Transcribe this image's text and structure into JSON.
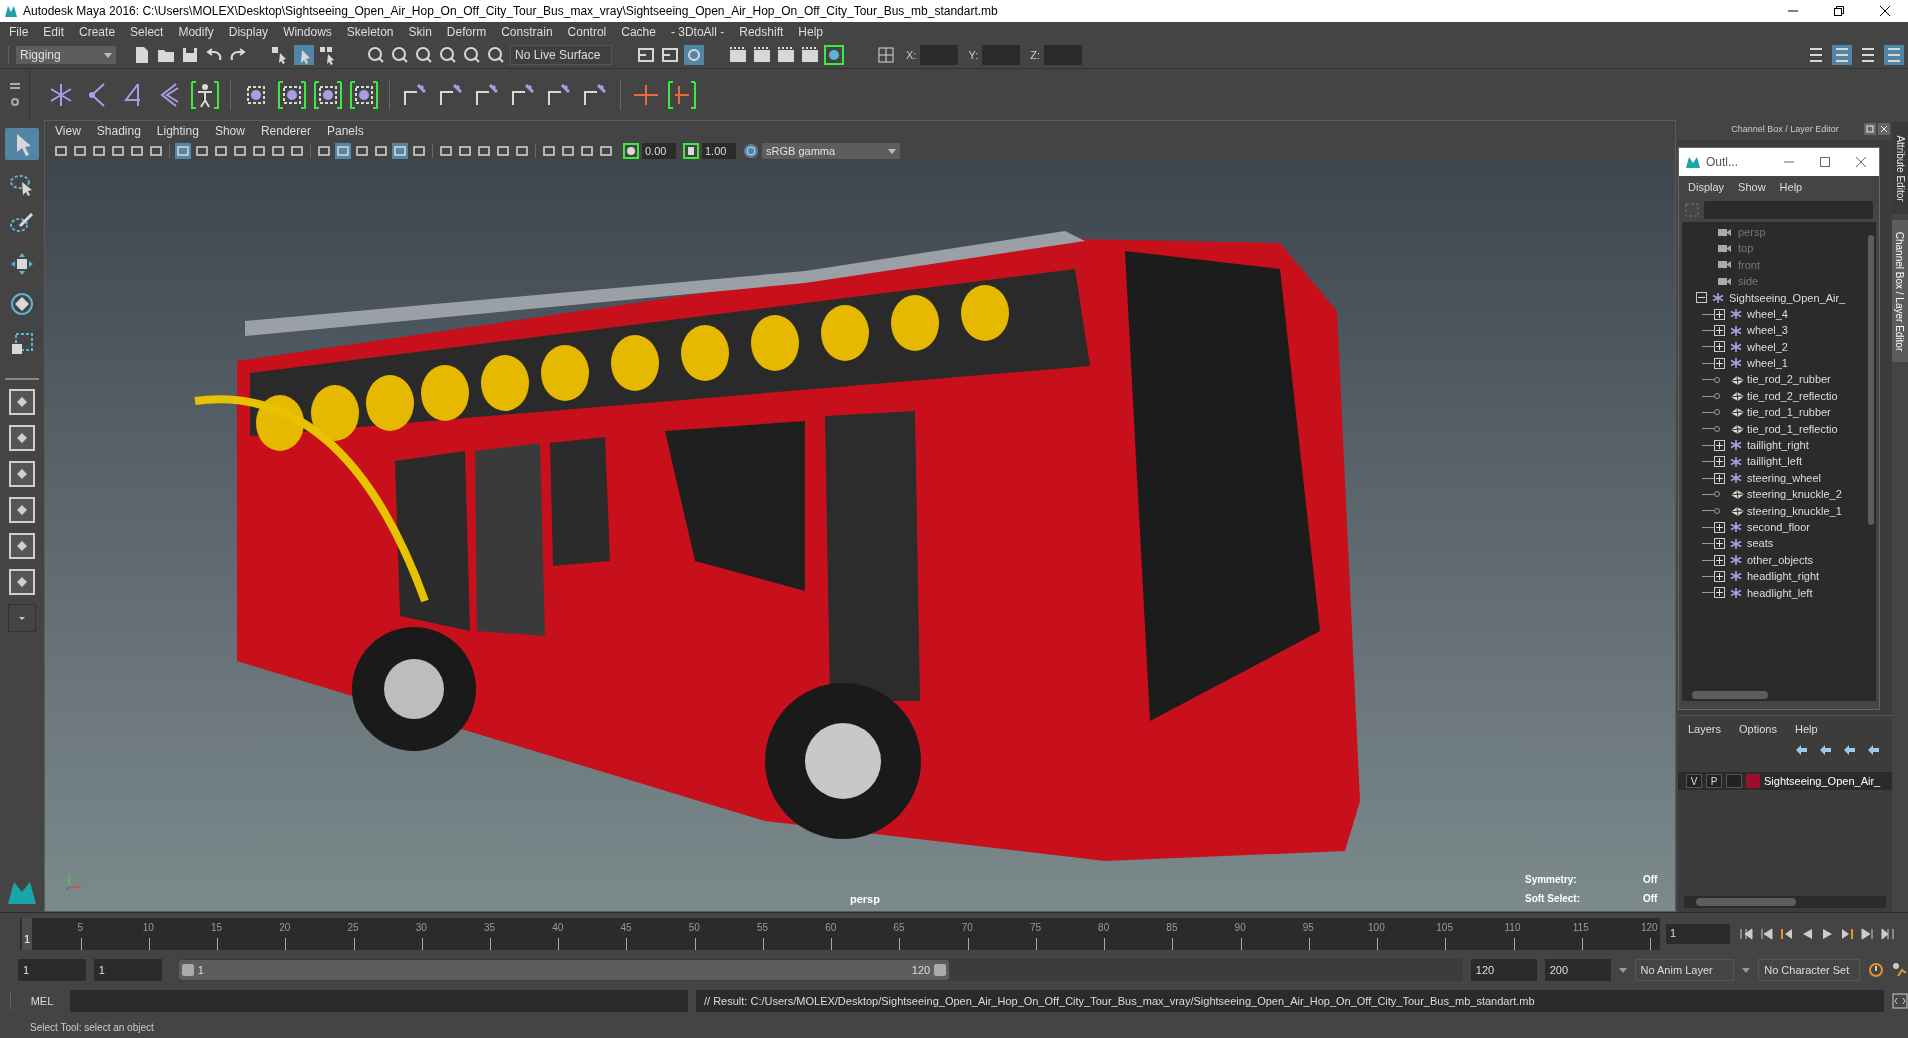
{
  "window": {
    "title": "Autodesk Maya 2016: C:\\Users\\MOLEX\\Desktop\\Sightseeing_Open_Air_Hop_On_Off_City_Tour_Bus_max_vray\\Sightseeing_Open_Air_Hop_On_Off_City_Tour_Bus_mb_standart.mb"
  },
  "menu_bar": [
    "File",
    "Edit",
    "Create",
    "Select",
    "Modify",
    "Display",
    "Windows",
    "Skeleton",
    "Skin",
    "Deform",
    "Constrain",
    "Control",
    "Cache",
    "- 3DtoAll -",
    "Redshift",
    "Help"
  ],
  "status_line": {
    "menu_set": "Rigging",
    "live_surface": "No Live Surface",
    "coords": [
      "X:",
      "Y:",
      "Z:"
    ]
  },
  "toolbox": {
    "tools": [
      {
        "selected": true
      },
      {
        "selected": false
      },
      {
        "selected": false
      },
      {
        "selected": false
      },
      {
        "selected": false
      },
      {
        "selected": false
      }
    ]
  },
  "viewport": {
    "menus": [
      "View",
      "Shading",
      "Lighting",
      "Show",
      "Renderer",
      "Panels"
    ],
    "exposure": "0.00",
    "gamma": "1.00",
    "color_space": "sRGB gamma",
    "camera": "persp",
    "hud": [
      {
        "label": "Symmetry:",
        "value": "Off"
      },
      {
        "label": "Soft Select:",
        "value": "Off"
      }
    ]
  },
  "channel_box": {
    "title": "Channel Box / Layer Editor"
  },
  "side_tabs": [
    {
      "label": "Attribute Editor",
      "selected": false
    },
    {
      "label": "Channel Box / Layer Editor",
      "selected": true
    }
  ],
  "outliner": {
    "title": "Outl...",
    "menus": [
      "Display",
      "Show",
      "Help"
    ],
    "items": [
      {
        "label": "persp",
        "kind": "camera"
      },
      {
        "label": "top",
        "kind": "camera"
      },
      {
        "label": "front",
        "kind": "camera"
      },
      {
        "label": "side",
        "kind": "camera"
      },
      {
        "label": "Sightseeing_Open_Air_",
        "kind": "group",
        "expanded": true,
        "children": [
          {
            "label": "wheel_4",
            "kind": "group",
            "expanded": false
          },
          {
            "label": "wheel_3",
            "kind": "group",
            "expanded": false
          },
          {
            "label": "wheel_2",
            "kind": "group",
            "expanded": false
          },
          {
            "label": "wheel_1",
            "kind": "group",
            "expanded": false
          },
          {
            "label": "tie_rod_2_rubber",
            "kind": "mesh"
          },
          {
            "label": "tie_rod_2_reflectio",
            "kind": "mesh"
          },
          {
            "label": "tie_rod_1_rubber",
            "kind": "mesh"
          },
          {
            "label": "tie_rod_1_reflectio",
            "kind": "mesh"
          },
          {
            "label": "taillight_right",
            "kind": "group",
            "expanded": false
          },
          {
            "label": "taillight_left",
            "kind": "group",
            "expanded": false
          },
          {
            "label": "steering_wheel",
            "kind": "group",
            "expanded": false
          },
          {
            "label": "steering_knuckle_2",
            "kind": "mesh"
          },
          {
            "label": "steering_knuckle_1",
            "kind": "mesh"
          },
          {
            "label": "second_floor",
            "kind": "group",
            "expanded": false
          },
          {
            "label": "seats",
            "kind": "group",
            "expanded": false
          },
          {
            "label": "other_objects",
            "kind": "group",
            "expanded": false
          },
          {
            "label": "headlight_right",
            "kind": "group",
            "expanded": false
          },
          {
            "label": "headlight_left",
            "kind": "group",
            "expanded": false
          }
        ]
      }
    ]
  },
  "layers": {
    "menus": [
      "Layers",
      "Options",
      "Help"
    ],
    "rows": [
      {
        "visible": "V",
        "playback": "P",
        "name": "Sightseeing_Open_Air_",
        "color": "#9b0f2e"
      }
    ]
  },
  "timeline": {
    "ticks": [
      "5",
      "10",
      "15",
      "20",
      "25",
      "30",
      "35",
      "40",
      "45",
      "50",
      "55",
      "60",
      "65",
      "70",
      "75",
      "80",
      "85",
      "90",
      "95",
      "100",
      "105",
      "110",
      "115",
      "120"
    ],
    "current": "1",
    "level": 0,
    "current_frame": "1"
  },
  "range": {
    "start": "1",
    "playback_start": "1",
    "slider_start": "1",
    "slider_end": "120",
    "level": 0.6,
    "playback_end": "120",
    "end": "200",
    "anim_layer": "No Anim Layer",
    "character_set": "No Character Set"
  },
  "command_line": {
    "language": "MEL",
    "result": "// Result: C:/Users/MOLEX/Desktop/Sightseeing_Open_Air_Hop_On_Off_City_Tour_Bus_max_vray/Sightseeing_Open_Air_Hop_On_Off_City_Tour_Bus_mb_standart.mb"
  },
  "help_line": "Select Tool: select an object"
}
